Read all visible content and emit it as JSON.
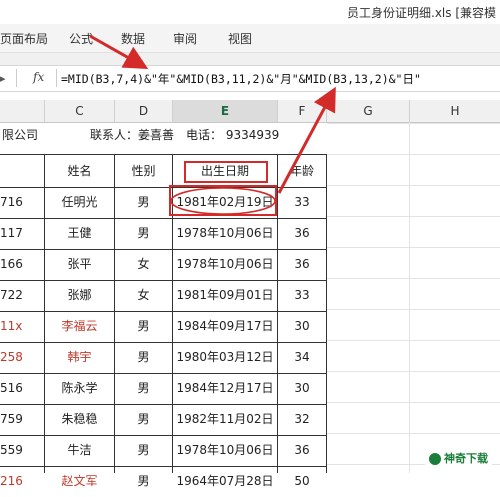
{
  "window": {
    "title": "员工身份证明细.xls  [兼容模"
  },
  "ribbon": {
    "tabs": [
      "页面布局",
      "公式",
      "数据",
      "审阅",
      "视图"
    ]
  },
  "formula_bar": {
    "name_box_tail": "▸",
    "fx_label": "fx",
    "formula": "=MID(B3,7,4)&\"年\"&MID(B3,11,2)&\"月\"&MID(B3,13,2)&\"日\""
  },
  "columns": [
    "C",
    "D",
    "E",
    "F",
    "G",
    "H"
  ],
  "selected_column": "E",
  "sheet": {
    "company_tail": "限公司",
    "contact": "联系人：姜喜善",
    "phone": "电话：  9334939",
    "headers": {
      "name": "姓名",
      "gender": "性别",
      "birth": "出生日期",
      "age": "年龄"
    },
    "rows": [
      {
        "b": "716",
        "name": "任明光",
        "gender": "男",
        "birth": "1981年02月19日",
        "age": "33",
        "red": false
      },
      {
        "b": "117",
        "name": "王健",
        "gender": "男",
        "birth": "1978年10月06日",
        "age": "36",
        "red": false
      },
      {
        "b": "166",
        "name": "张平",
        "gender": "女",
        "birth": "1978年10月06日",
        "age": "36",
        "red": false
      },
      {
        "b": "722",
        "name": "张娜",
        "gender": "女",
        "birth": "1981年09月01日",
        "age": "33",
        "red": false
      },
      {
        "b": "11x",
        "name": "李福云",
        "gender": "男",
        "birth": "1984年09月17日",
        "age": "30",
        "red": true
      },
      {
        "b": "258",
        "name": "韩宇",
        "gender": "男",
        "birth": "1980年03月12日",
        "age": "34",
        "red": true
      },
      {
        "b": "516",
        "name": "陈永学",
        "gender": "男",
        "birth": "1984年12月17日",
        "age": "30",
        "red": false
      },
      {
        "b": "759",
        "name": "朱稳稳",
        "gender": "男",
        "birth": "1982年11月02日",
        "age": "32",
        "red": false
      },
      {
        "b": "559",
        "name": "牛洁",
        "gender": "男",
        "birth": "1978年10月06日",
        "age": "36",
        "red": false
      },
      {
        "b": "216",
        "name": "赵文军",
        "gender": "男",
        "birth": "1964年07月28日",
        "age": "50",
        "red": true
      }
    ]
  },
  "watermark": {
    "text": "神奇下载"
  },
  "colors": {
    "annotation_red": "#d32a2a",
    "excel_green": "#1d6a3e"
  }
}
